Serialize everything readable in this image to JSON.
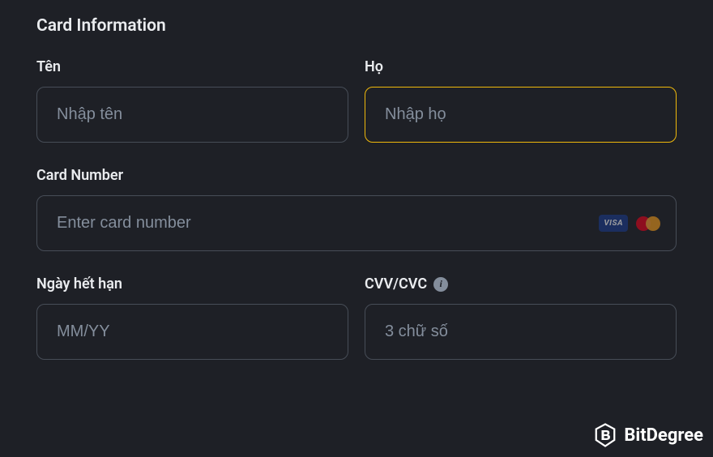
{
  "section_title": "Card Information",
  "fields": {
    "first_name": {
      "label": "Tên",
      "placeholder": "Nhập tên",
      "value": ""
    },
    "last_name": {
      "label": "Họ",
      "placeholder": "Nhập họ",
      "value": ""
    },
    "card_number": {
      "label": "Card Number",
      "placeholder": "Enter card number",
      "value": ""
    },
    "expiry": {
      "label": "Ngày hết hạn",
      "placeholder": "MM/YY",
      "value": ""
    },
    "cvv": {
      "label": "CVV/CVC",
      "placeholder": "3 chữ số",
      "value": ""
    }
  },
  "card_brands": {
    "visa": "VISA",
    "mastercard": "mastercard"
  },
  "watermark": "BitDegree"
}
